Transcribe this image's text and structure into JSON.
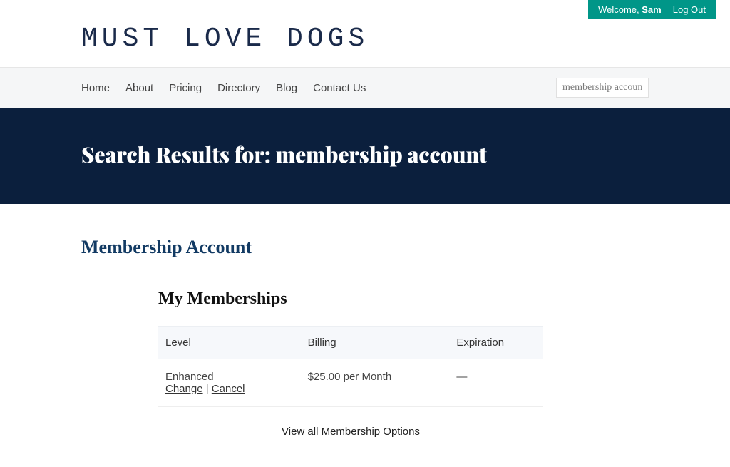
{
  "topbar": {
    "welcome_prefix": "Welcome, ",
    "welcome_name": "Sam",
    "logout": "Log Out"
  },
  "logo": "MUST LOVE DOGS",
  "nav": {
    "items": [
      "Home",
      "About",
      "Pricing",
      "Directory",
      "Blog",
      "Contact Us"
    ],
    "search_value": "membership account"
  },
  "hero": {
    "title": "Search Results for: membership account"
  },
  "page": {
    "subtitle": "Membership Account"
  },
  "memberships": {
    "heading": "My Memberships",
    "columns": {
      "level": "Level",
      "billing": "Billing",
      "expiration": "Expiration"
    },
    "rows": [
      {
        "level": "Enhanced",
        "billing": "$25.00 per Month",
        "expiration": "—",
        "change_label": "Change",
        "cancel_label": "Cancel"
      }
    ],
    "view_all": "View all Membership Options"
  }
}
